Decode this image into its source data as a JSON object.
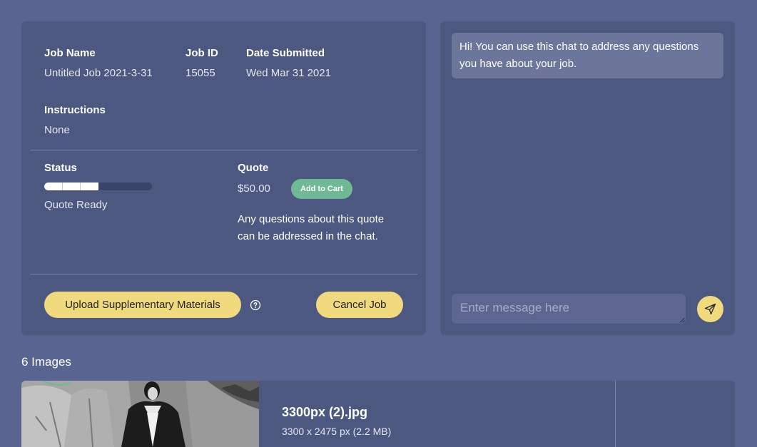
{
  "job": {
    "name_label": "Job Name",
    "name_value": "Untitled Job 2021-3-31",
    "id_label": "Job ID",
    "id_value": "15055",
    "date_label": "Date Submitted",
    "date_value": "Wed Mar 31 2021",
    "instructions_label": "Instructions",
    "instructions_value": "None",
    "status_label": "Status",
    "status_value": "Quote Ready",
    "status_progress_percent": 50,
    "status_progress_steps": 6,
    "quote_label": "Quote",
    "quote_value": "$50.00",
    "add_to_cart_label": "Add to Cart",
    "quote_note": "Any questions about this quote can be addressed in the chat.",
    "upload_label": "Upload Supplementary Materials",
    "cancel_label": "Cancel Job"
  },
  "chat": {
    "welcome_message": "Hi! You can use this chat to address any questions you have about your job.",
    "input_placeholder": "Enter message here"
  },
  "images": {
    "count_title": "6 Images",
    "items": [
      {
        "file_name": "3300px (2).jpg",
        "meta": "3300 x 2475 px (2.2 MB)"
      }
    ]
  },
  "colors": {
    "page_background": "#5a6490",
    "card_background": "#4d5881",
    "accent_yellow": "#f1d97e",
    "accent_green": "#6fba95"
  },
  "icons": {
    "help": "question-circle-icon",
    "send": "paper-plane-icon",
    "resize": "resize-grip-icon"
  }
}
